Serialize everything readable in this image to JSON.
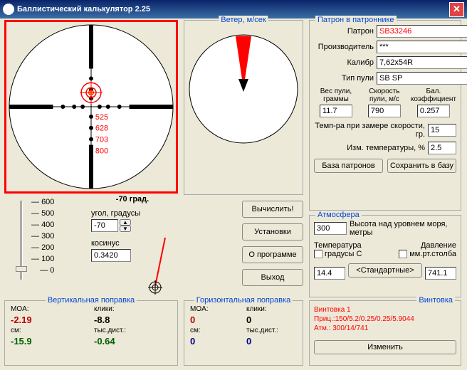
{
  "title": "Баллистический калькулятор 2.25",
  "scope_marks": [
    "525",
    "628",
    "703",
    "800"
  ],
  "slider_ticks": [
    "600",
    "500",
    "400",
    "300",
    "200",
    "100",
    "0"
  ],
  "angle": {
    "label": "угол, градусы",
    "readout": "-70 град.",
    "value": "-70",
    "cos_label": "косинус",
    "cos_value": "0.3420"
  },
  "wind_label": "Ветер, м/сек",
  "buttons": {
    "calc": "Вычислить!",
    "settings": "Установки",
    "about": "О программе",
    "exit": "Выход"
  },
  "cartridge": {
    "legend": "Патрон в патроннике",
    "fields": {
      "patron_lbl": "Патрон",
      "patron": "SB33246",
      "maker_lbl": "Производитель",
      "maker": "***",
      "caliber_lbl": "Калибр",
      "caliber": "7,62x54R",
      "bullet_type_lbl": "Тип пули",
      "bullet_type": "SB SP",
      "weight_lbl": "Вес пули, граммы",
      "weight": "11.7",
      "speed_lbl": "Скорость пули, м/с",
      "speed": "790",
      "bc_lbl": "Бал. коэффициент",
      "bc": "0.257",
      "temp_meas_lbl": "Темп-ра при замере скорости, гр.",
      "temp_meas": "15",
      "temp_delta_lbl": "Изм. температуры, %",
      "temp_delta": "2.5"
    },
    "db_btn": "База патронов",
    "save_btn": "Сохранить в базу"
  },
  "atmo": {
    "legend": "Атмосфера",
    "alt": "300",
    "alt_lbl": "Высота над уровнем моря, метры",
    "temp_lbl": "Температура",
    "temp_unit": "градусы C",
    "temp": "14.4",
    "press_lbl": "Давление",
    "press_unit": "мм.рт.столба",
    "press": "741.1",
    "std_btn": "<Стандартные>"
  },
  "vcorr": {
    "legend": "Вертикальная поправка",
    "moa_lbl": "MOA:",
    "moa": "-2.19",
    "clicks_lbl": "клики:",
    "clicks": "-8.8",
    "cm_lbl": "см:",
    "cm": "-15.9",
    "mils_lbl": "тыс.дист.:",
    "mils": "-0.64"
  },
  "hcorr": {
    "legend": "Горизонтальная поправка",
    "moa_lbl": "MOA:",
    "moa": "0",
    "clicks_lbl": "клики:",
    "clicks": "0",
    "cm_lbl": "см:",
    "cm": "0",
    "mils_lbl": "тыс.дист.:",
    "mils": "0"
  },
  "rifle": {
    "legend": "Винтовка",
    "name": "Винтовка 1",
    "scope": "Приц.:150/5.2/0.25/0.25/5.9044",
    "atm": "Атм.: 300/14/741",
    "change_btn": "Изменить"
  }
}
